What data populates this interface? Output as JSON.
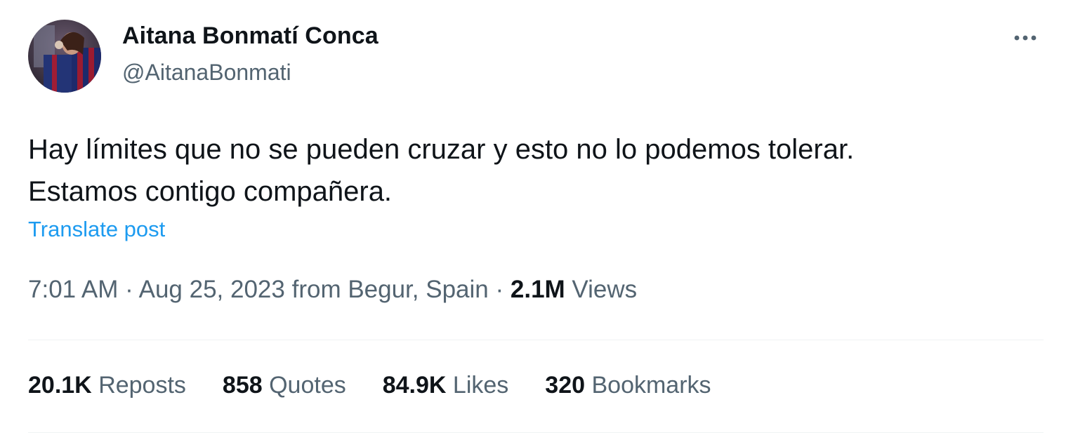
{
  "author": {
    "display_name": "Aitana Bonmatí Conca",
    "handle": "@AitanaBonmati"
  },
  "icons": {
    "more": "more-horizontal-icon",
    "avatar": "profile-avatar-image"
  },
  "tweet": {
    "lines": [
      "Hay límites que no se pueden cruzar y esto no lo podemos tolerar.",
      "Estamos contigo compañera."
    ],
    "translate_label": "Translate post"
  },
  "meta": {
    "time": "7:01 AM",
    "separator": "·",
    "date": "Aug 25, 2023",
    "location": "from Begur, Spain",
    "views_count": "2.1M",
    "views_label": "Views"
  },
  "stats": [
    {
      "count": "20.1K",
      "label": "Reposts"
    },
    {
      "count": "858",
      "label": "Quotes"
    },
    {
      "count": "84.9K",
      "label": "Likes"
    },
    {
      "count": "320",
      "label": "Bookmarks"
    }
  ],
  "colors": {
    "primary_text": "#0f1419",
    "secondary_text": "#536471",
    "link": "#1d9bf0",
    "divider": "#eff3f4"
  }
}
